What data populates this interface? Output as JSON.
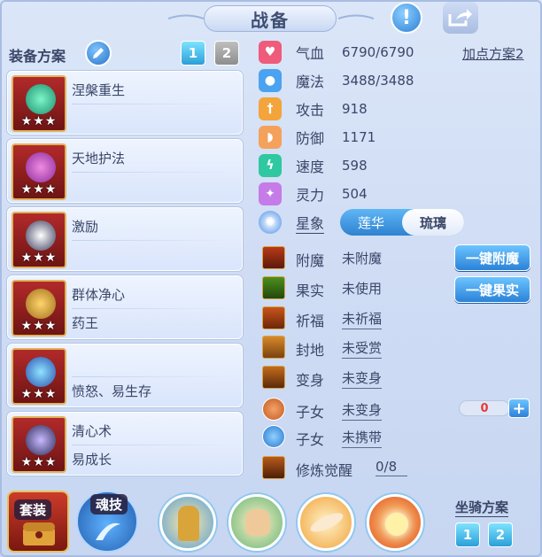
{
  "title": "战备",
  "colors": {
    "accent": "#2a82d8",
    "card_bg": "#e6eefc",
    "counter_red": "#e53b3b"
  },
  "header": {
    "info_icon": "exclamation-icon",
    "share_icon": "share-icon"
  },
  "equip_plan": {
    "title": "装备方案",
    "edit_icon": "pencil-icon",
    "plan_buttons": [
      "1",
      "2"
    ],
    "selected_plan": "1",
    "cards": [
      {
        "name": "涅槃重生",
        "sub": "",
        "stars": "★★★"
      },
      {
        "name": "天地护法",
        "sub": "",
        "stars": "★★★"
      },
      {
        "name": "激励",
        "sub": "",
        "stars": "★★★"
      },
      {
        "name": "群体净心",
        "sub": "药王",
        "stars": "★★★"
      },
      {
        "name": "",
        "sub": "愤怒、易生存",
        "stars": "★★★"
      },
      {
        "name": "清心术",
        "sub": "易成长",
        "stars": "★★★"
      }
    ]
  },
  "stats": {
    "add_point_plan": "加点方案2",
    "rows": [
      {
        "label": "气血",
        "value": "6790/6790",
        "icon": "heart-icon",
        "color": "#ef5b7a"
      },
      {
        "label": "魔法",
        "value": "3488/3488",
        "icon": "water-drop-icon",
        "color": "#4aa3f0"
      },
      {
        "label": "攻击",
        "value": "918",
        "icon": "sword-icon",
        "color": "#f3a43a"
      },
      {
        "label": "防御",
        "value": "1171",
        "icon": "shield-icon",
        "color": "#f4a15b"
      },
      {
        "label": "速度",
        "value": "598",
        "icon": "lightning-icon",
        "color": "#2fc8a0"
      },
      {
        "label": "灵力",
        "value": "504",
        "icon": "sparkle-icon",
        "color": "#c57be8"
      }
    ],
    "xingxiang": {
      "label": "星象",
      "options": [
        "莲华",
        "琉璃"
      ],
      "selected": "琉璃"
    }
  },
  "items": [
    {
      "label": "附魔",
      "value": "未附魔",
      "underline": false
    },
    {
      "label": "果实",
      "value": "未使用",
      "underline": false
    },
    {
      "label": "祈福",
      "value": "未祈福",
      "underline": true
    },
    {
      "label": "封地",
      "value": "未受赏",
      "underline": true
    },
    {
      "label": "变身",
      "value": "未变身",
      "underline": true
    },
    {
      "label": "子女",
      "value": "未变身",
      "underline": true
    },
    {
      "label": "子女",
      "value": "未携带",
      "underline": true
    },
    {
      "label": "修炼觉醒",
      "value": "0/8",
      "underline": true
    }
  ],
  "actions": {
    "enchant": "一键附魔",
    "fruit": "一键果实"
  },
  "counter": {
    "value": "0",
    "plus": "+"
  },
  "bottom": {
    "tab_zhuang": "套装",
    "tab_hun": "魂技",
    "mount_title": "坐骑方案",
    "mount_buttons": [
      "1",
      "2"
    ]
  }
}
